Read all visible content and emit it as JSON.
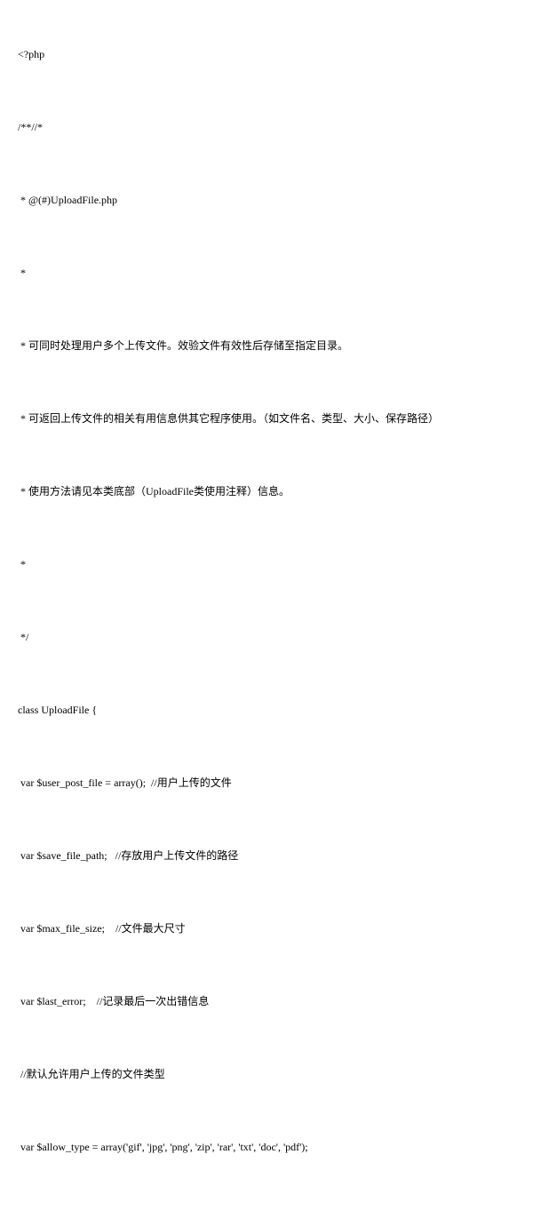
{
  "code": {
    "lines": [
      "<?php",
      "/**//*",
      " * @(#)UploadFile.php",
      " *",
      " * 可同时处理用户多个上传文件。效验文件有效性后存储至指定目录。",
      " * 可返回上传文件的相关有用信息供其它程序使用。（如文件名、类型、大小、保存路径）",
      " * 使用方法请见本类底部（UploadFile类使用注释）信息。",
      " *",
      " */",
      "class UploadFile {",
      " var $user_post_file = array();  //用户上传的文件",
      " var $save_file_path;   //存放用户上传文件的路径",
      " var $max_file_size;    //文件最大尺寸",
      " var $last_error;    //记录最后一次出错信息",
      " //默认允许用户上传的文件类型",
      " var $allow_type = array('gif', 'jpg', 'png', 'zip', 'rar', 'txt', 'doc', 'pdf');"
    ]
  }
}
